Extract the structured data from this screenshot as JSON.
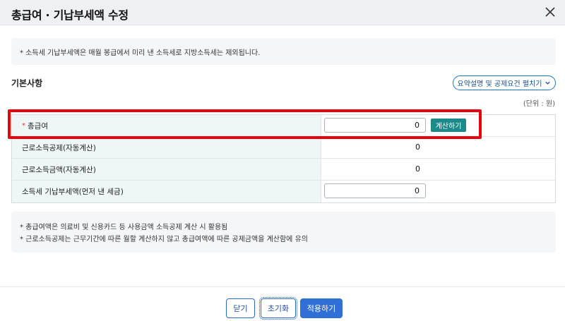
{
  "dialog": {
    "title": "총급여 · 기납부세액 수정",
    "close_icon": "close-icon"
  },
  "notice": {
    "text": "* 소득세 기납부세액은 매월 봉급에서 미리 낸 소득세로 지방소득세는 제외됩니다."
  },
  "section": {
    "title": "기본사항",
    "summary_button": "요약설명 및 공제요건 펼치기",
    "unit": "(단위 : 원)"
  },
  "table": {
    "rows": [
      {
        "label": "총급여",
        "required": "*",
        "value": "0",
        "button": "계산하기"
      },
      {
        "label": "근로소득공제(자동계산)",
        "value": "0"
      },
      {
        "label": "근로소득금액(자동계산)",
        "value": "0"
      },
      {
        "label": "소득세 기납부세액(먼저 낸 세금)",
        "value": "0"
      }
    ]
  },
  "notes": [
    "* 총급여액은 의료비 및 신용카드 등 사용금액 소득공제 계산 시 활용됨",
    "* 근로소득공제는 근무기간에 따른 월할 계산하지 않고 총급여액에 따른 공제금액을 계산함에 유의"
  ],
  "footer": {
    "close_label": "닫기",
    "reset_label": "초기화",
    "apply_label": "적용하기"
  },
  "colors": {
    "accent": "#2f6fd6",
    "calc_button": "#1b8a8a",
    "highlight": "#e8000b",
    "label_bg": "#eef6f6"
  }
}
